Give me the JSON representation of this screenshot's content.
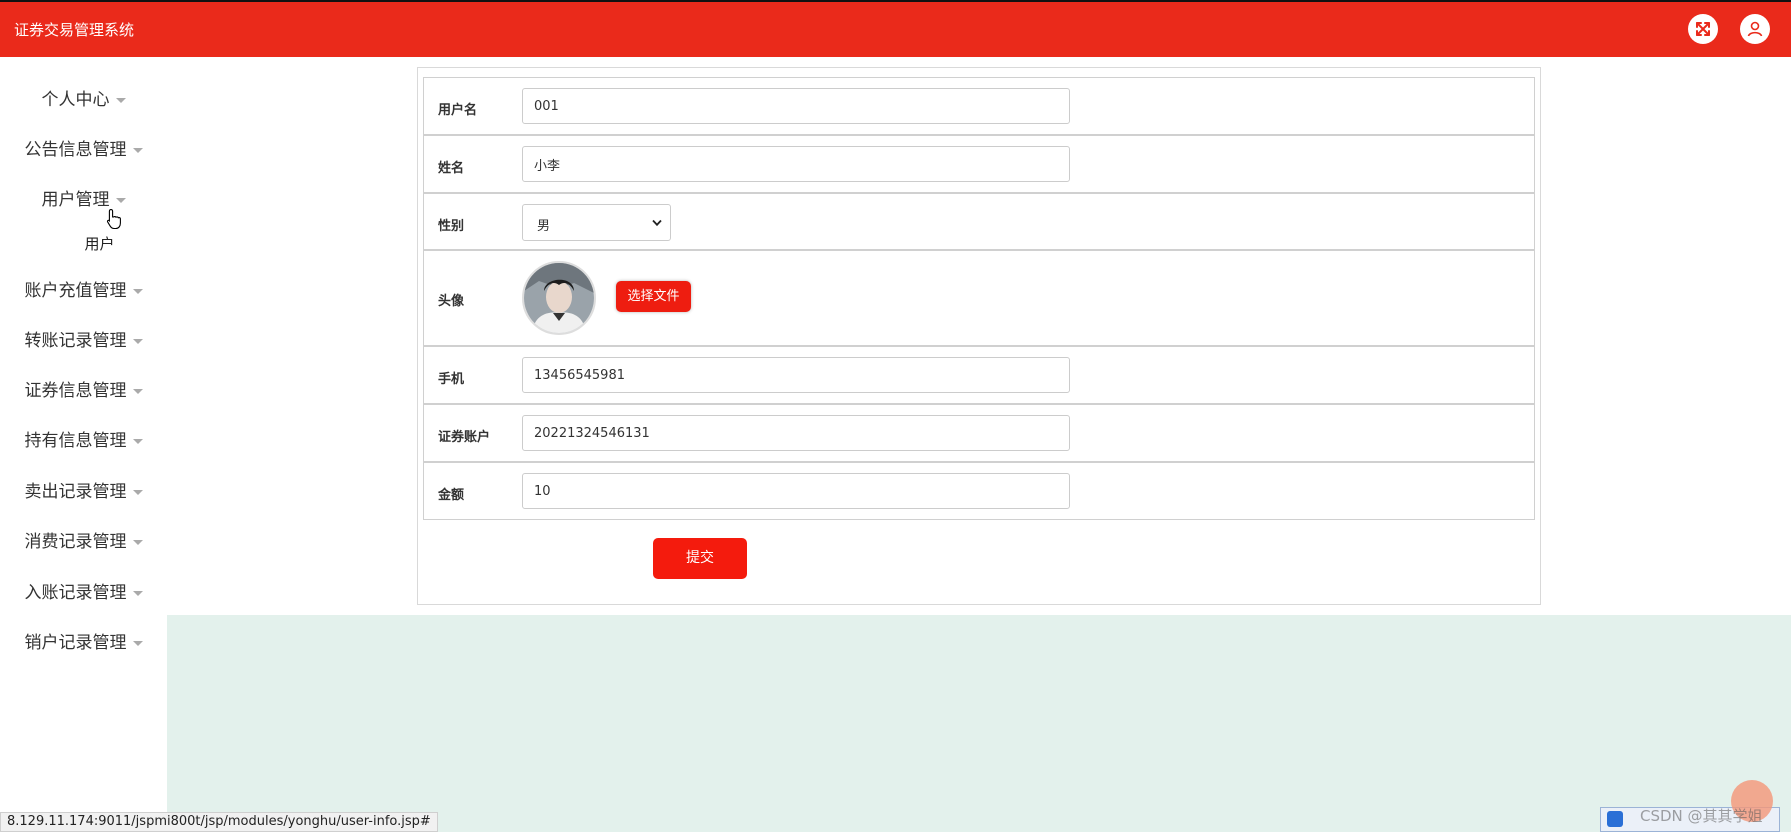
{
  "header": {
    "title": "证券交易管理系统",
    "fullscreen_icon": "fullscreen-icon",
    "user_icon": "user-avatar-icon",
    "accent_color": "#ea2a1b"
  },
  "sidebar": {
    "items": [
      {
        "label": "个人中心"
      },
      {
        "label": "公告信息管理"
      },
      {
        "label": "用户管理",
        "expanded": true,
        "children": [
          "用户"
        ]
      },
      {
        "label": "账户充值管理"
      },
      {
        "label": "转账记录管理"
      },
      {
        "label": "证券信息管理"
      },
      {
        "label": "持有信息管理"
      },
      {
        "label": "卖出记录管理"
      },
      {
        "label": "消费记录管理"
      },
      {
        "label": "入账记录管理"
      },
      {
        "label": "销户记录管理"
      }
    ]
  },
  "form": {
    "username": {
      "label": "用户名",
      "value": "001"
    },
    "name": {
      "label": "姓名",
      "value": "小李"
    },
    "gender": {
      "label": "性别",
      "value": "男"
    },
    "avatar": {
      "label": "头像",
      "button": "选择文件"
    },
    "phone": {
      "label": "手机",
      "value": "13456545981"
    },
    "account": {
      "label": "证券账户",
      "value": "20221324546131"
    },
    "amount": {
      "label": "金额",
      "value": "10"
    },
    "submit": "提交"
  },
  "status_bar": {
    "url": "8.129.11.174:9011/jspmi800t/jsp/modules/yonghu/user-info.jsp#"
  },
  "watermark": "CSDN @其其学姐"
}
